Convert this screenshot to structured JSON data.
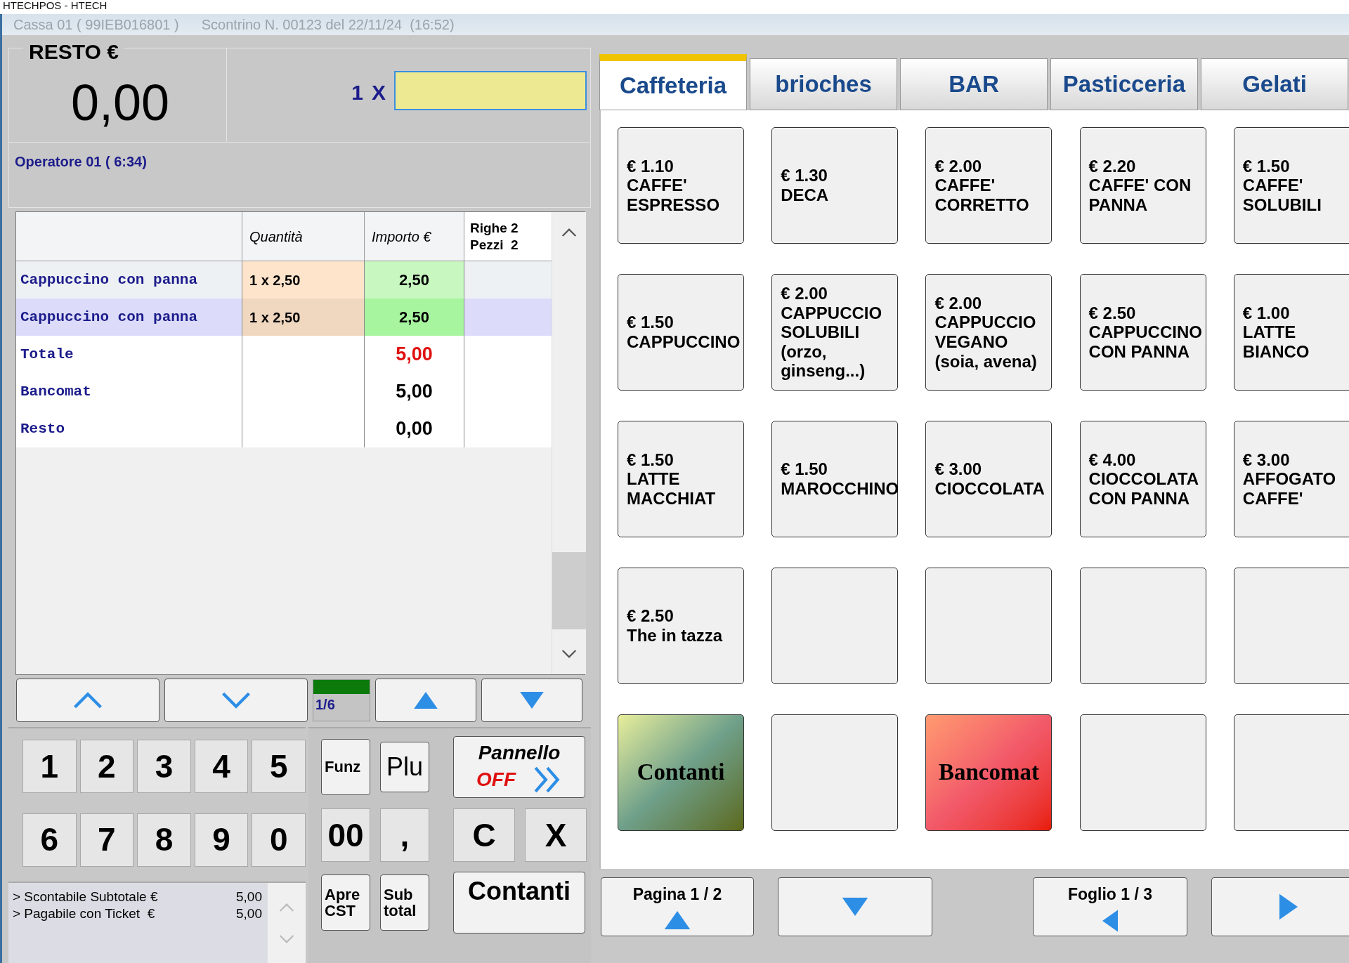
{
  "window": {
    "title": "HTECHPOS - HTECH"
  },
  "header": {
    "register": "Cassa 01 ( 99IEB016801 )",
    "receipt": "Scontrino N. 00123 del 22/11/24  (16:52)"
  },
  "change_display": {
    "label": "RESTO €",
    "value": "0,00"
  },
  "quantity_entry": {
    "multiplier": "1",
    "times": "X"
  },
  "operator": "Operatore 01 ( 6:34)",
  "receipt_table": {
    "columns": [
      "Quantità",
      "Importo €"
    ],
    "counts": [
      "Righe 2",
      "Pezzi  2"
    ],
    "rows": [
      {
        "kind": "item",
        "name": "Cappuccino con panna",
        "quantity": "1 x 2,50",
        "amount": "2,50",
        "selected": false
      },
      {
        "kind": "item",
        "name": "Cappuccino con panna",
        "quantity": "1 x 2,50",
        "amount": "2,50",
        "selected": true
      },
      {
        "kind": "total",
        "name": "Totale",
        "amount": "5,00",
        "selected": false
      },
      {
        "kind": "summary",
        "name": "Bancomat",
        "amount": "5,00",
        "selected": false
      },
      {
        "kind": "summary",
        "name": "Resto",
        "amount": "0,00",
        "selected": false
      }
    ]
  },
  "page_indicator": {
    "label": "1/6",
    "level": 1
  },
  "keypad": {
    "digits": [
      "1",
      "2",
      "3",
      "4",
      "5",
      "6",
      "7",
      "8",
      "9",
      "0"
    ],
    "functions": [
      {
        "kind": "small",
        "label": "Funz"
      },
      {
        "kind": "medium",
        "label": "Plu"
      },
      {
        "kind": "panel",
        "label": "Pannello",
        "state": "OFF"
      },
      {
        "kind": "key",
        "label": "00"
      },
      {
        "kind": "key",
        "label": ","
      },
      {
        "kind": "key",
        "label": "C"
      },
      {
        "kind": "key",
        "label": "X"
      },
      {
        "kind": "small",
        "label": "Apre CST"
      },
      {
        "kind": "small",
        "label": "Sub total"
      },
      {
        "kind": "wide",
        "label": "Contanti"
      }
    ]
  },
  "info_lines": [
    {
      "label": "> Scontabile Subtotale €",
      "value": "5,00"
    },
    {
      "label": "> Pagabile con Ticket  €",
      "value": "5,00"
    }
  ],
  "category_tabs": [
    {
      "label": "Caffeteria",
      "selected": true
    },
    {
      "label": "brioches",
      "selected": false
    },
    {
      "label": "BAR",
      "selected": false
    },
    {
      "label": "Pasticceria",
      "selected": false
    },
    {
      "label": "Gelati",
      "selected": false
    }
  ],
  "products": [
    {
      "kind": "product",
      "price": "€ 1.10",
      "name": "CAFFE' ESPRESSO"
    },
    {
      "kind": "product",
      "price": "€ 1.30",
      "name": "DECA"
    },
    {
      "kind": "product",
      "price": "€ 2.00",
      "name": "CAFFE' CORRETTO"
    },
    {
      "kind": "product",
      "price": "€ 2.20",
      "name": "CAFFE' CON PANNA"
    },
    {
      "kind": "product",
      "price": "€ 1.50",
      "name": "CAFFE' SOLUBILI"
    },
    {
      "kind": "product",
      "price": "€ 1.50",
      "name": "CAPPUCCINO"
    },
    {
      "kind": "product",
      "price": "€ 2.00",
      "name": "CAPPUCCIO SOLUBILI (orzo, ginseng...)"
    },
    {
      "kind": "product",
      "price": "€ 2.00",
      "name": "CAPPUCCIO VEGANO (soia, avena)"
    },
    {
      "kind": "product",
      "price": "€ 2.50",
      "name": "CAPPUCCINO CON PANNA"
    },
    {
      "kind": "product",
      "price": "€ 1.00",
      "name": "LATTE BIANCO"
    },
    {
      "kind": "product",
      "price": "€ 1.50",
      "name": "LATTE MACCHIAT"
    },
    {
      "kind": "product",
      "price": "€ 1.50",
      "name": "MAROCCHINO"
    },
    {
      "kind": "product",
      "price": "€ 3.00",
      "name": "CIOCCOLATA"
    },
    {
      "kind": "product",
      "price": "€ 4.00",
      "name": "CIOCCOLATA CON PANNA"
    },
    {
      "kind": "product",
      "price": "€ 3.00",
      "name": "AFFOGATO CAFFE'"
    },
    {
      "kind": "product",
      "price": "€ 2.50",
      "name": "The in tazza"
    },
    {
      "kind": "empty"
    },
    {
      "kind": "empty"
    },
    {
      "kind": "empty"
    },
    {
      "kind": "empty"
    },
    {
      "kind": "cash",
      "name": "Contanti"
    },
    {
      "kind": "empty"
    },
    {
      "kind": "card",
      "name": "Bancomat"
    },
    {
      "kind": "empty"
    },
    {
      "kind": "empty"
    }
  ],
  "bottom_nav": {
    "page": "Pagina 1 / 2",
    "sheet": "Foglio 1 / 3"
  }
}
